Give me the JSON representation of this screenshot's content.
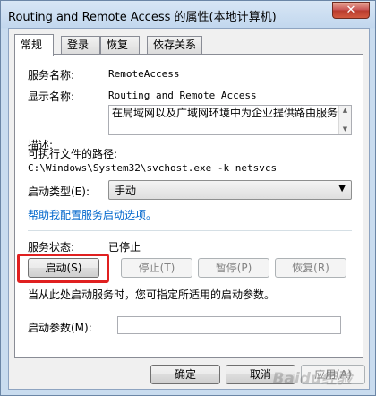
{
  "window": {
    "title": "Routing and Remote Access 的属性(本地计算机)",
    "close_glyph": "✕"
  },
  "tabs": [
    "常规",
    "登录",
    "恢复",
    "依存关系"
  ],
  "general": {
    "service_name_label": "服务名称:",
    "service_name_value": "RemoteAccess",
    "display_name_label": "显示名称:",
    "display_name_value": "Routing and Remote Access",
    "description_label": "描述:",
    "description_value": "在局域网以及广域网环境中为企业提供路由服务。",
    "exe_path_label": "可执行文件的路径:",
    "exe_path_value": "C:\\Windows\\System32\\svchost.exe -k netsvcs",
    "startup_type_label": "启动类型(E):",
    "startup_type_value": "手动",
    "help_link": "帮助我配置服务启动选项。",
    "service_status_label": "服务状态:",
    "service_status_value": "已停止",
    "buttons": {
      "start": "启动(S)",
      "stop": "停止(T)",
      "pause": "暂停(P)",
      "resume": "恢复(R)"
    },
    "hint": "当从此处启动服务时，您可指定所适用的启动参数。",
    "start_params_label": "启动参数(M):",
    "start_params_value": ""
  },
  "footer": {
    "ok": "确定",
    "cancel": "取消",
    "apply": "应用(A)"
  },
  "watermark": "Baidu经验",
  "colors": {
    "highlight": "#e02020",
    "link": "#0066cc"
  }
}
